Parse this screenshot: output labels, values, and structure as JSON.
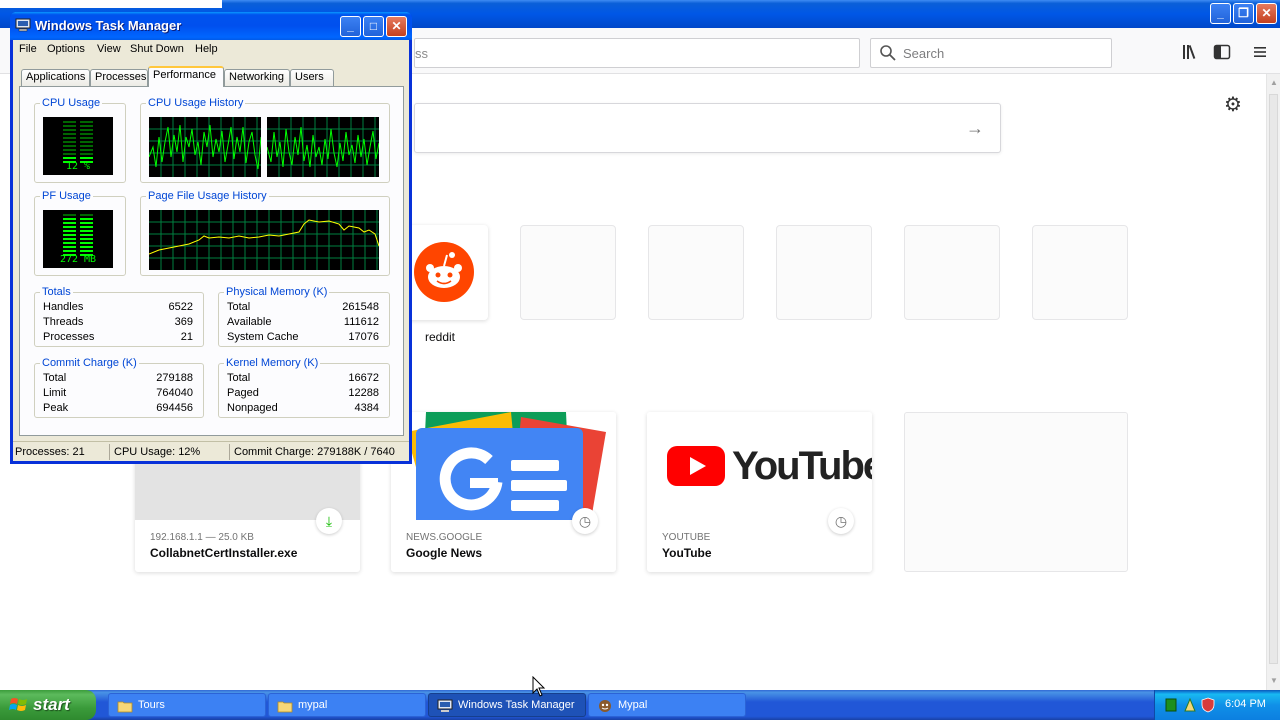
{
  "browser": {
    "url_placeholder_fragment": "ss",
    "search_placeholder": "Search",
    "top_sites": [
      {
        "label": "reddit"
      }
    ],
    "highlights": [
      {
        "host": "192.168.1.1 — 25.0 KB",
        "title": "CollabnetCertInstaller.exe",
        "badge": "download-icon"
      },
      {
        "host": "NEWS.GOOGLE",
        "title": "Google News",
        "badge": "clock-icon"
      },
      {
        "host": "YOUTUBE",
        "title": "YouTube",
        "badge": "clock-icon"
      }
    ],
    "youtube_logo_text": "YouTube"
  },
  "taskmgr": {
    "title": "Windows Task Manager",
    "menu": [
      "File",
      "Options",
      "View",
      "Shut Down",
      "Help"
    ],
    "tabs": [
      "Applications",
      "Processes",
      "Performance",
      "Networking",
      "Users"
    ],
    "active_tab": "Performance",
    "cpu_usage_label": "CPU Usage",
    "cpu_usage_value": "12 %",
    "cpu_history_label": "CPU Usage History",
    "pf_usage_label": "PF Usage",
    "pf_usage_value": "272 MB",
    "pf_history_label": "Page File Usage History",
    "totals": {
      "label": "Totals",
      "rows": [
        [
          "Handles",
          "6522"
        ],
        [
          "Threads",
          "369"
        ],
        [
          "Processes",
          "21"
        ]
      ]
    },
    "physical": {
      "label": "Physical Memory (K)",
      "rows": [
        [
          "Total",
          "261548"
        ],
        [
          "Available",
          "111612"
        ],
        [
          "System Cache",
          "17076"
        ]
      ]
    },
    "commit": {
      "label": "Commit Charge (K)",
      "rows": [
        [
          "Total",
          "279188"
        ],
        [
          "Limit",
          "764040"
        ],
        [
          "Peak",
          "694456"
        ]
      ]
    },
    "kernel": {
      "label": "Kernel Memory (K)",
      "rows": [
        [
          "Total",
          "16672"
        ],
        [
          "Paged",
          "12288"
        ],
        [
          "Nonpaged",
          "4384"
        ]
      ]
    },
    "status": {
      "processes": "Processes: 21",
      "cpu": "CPU Usage: 12%",
      "commit": "Commit Charge: 279188K / 7640"
    }
  },
  "taskbar": {
    "start_label": "start",
    "tasks": [
      {
        "label": "Tours",
        "icon": "folder-icon"
      },
      {
        "label": "mypal",
        "icon": "folder-icon"
      },
      {
        "label": "Windows Task Manager",
        "icon": "taskmgr-icon",
        "active": true
      },
      {
        "label": "Mypal",
        "icon": "mypal-icon"
      }
    ],
    "clock": "6:04 PM"
  },
  "colors": {
    "xp_blue": "#0054e3",
    "start_green": "#3a9b3a",
    "graph_green": "#00ff00",
    "graph_yellow": "#ffff00",
    "youtube_red": "#ff0000",
    "reddit_orange": "#ff4500"
  }
}
